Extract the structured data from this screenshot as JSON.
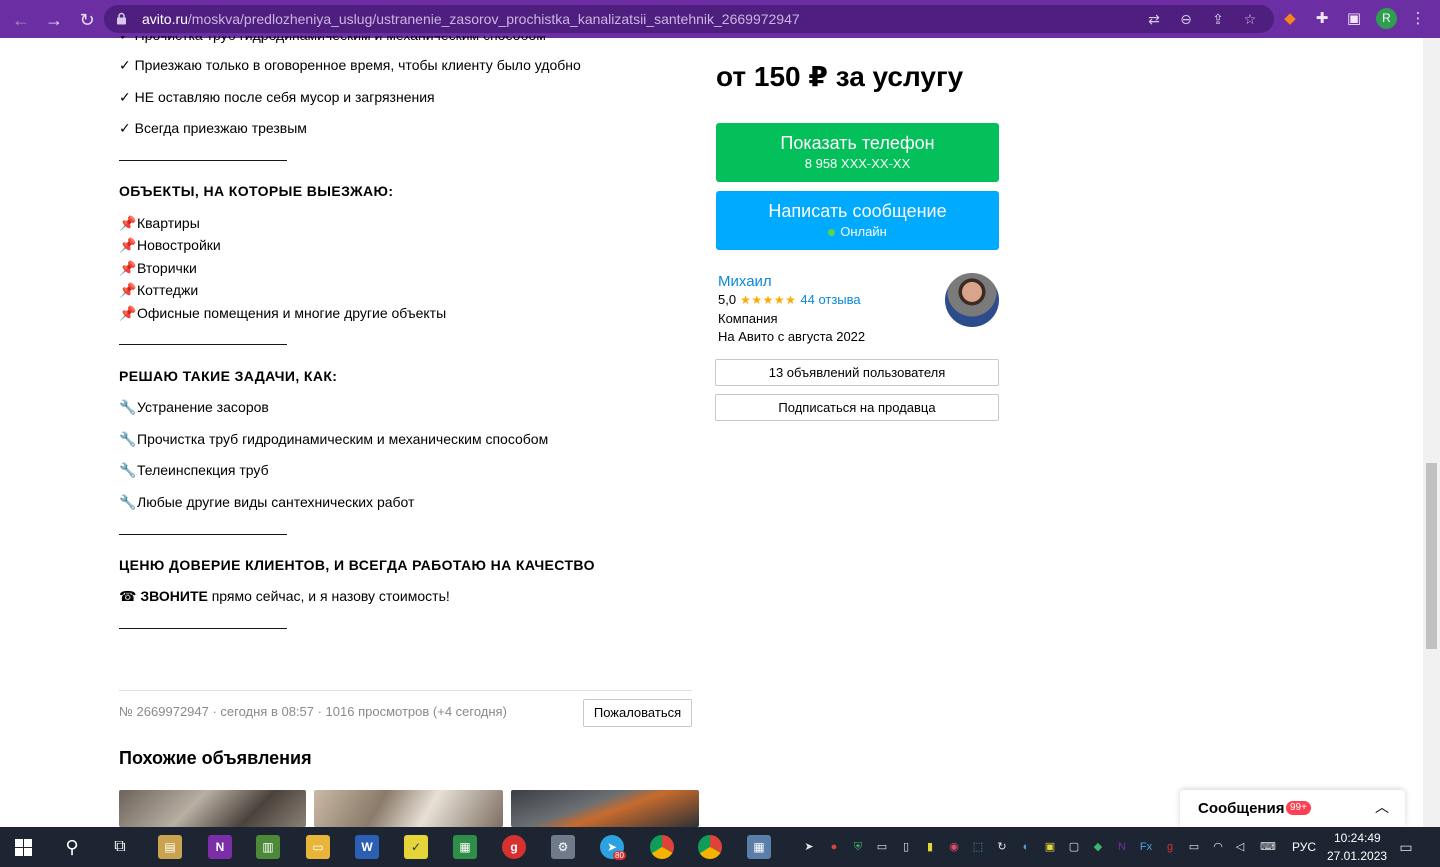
{
  "browser": {
    "url_host": "avito.ru",
    "url_path": "/moskva/predlozheniya_uslug/ustranenie_zasorov_prochistka_kanalizatsii_santehnik_2669972947",
    "profile_initial": "R"
  },
  "description": {
    "partial_top": "✓ Прочистка труб гидродинамическим и механическим способом",
    "checks": [
      "✓ Приезжаю только в оговоренное время, чтобы клиенту было удобно",
      "✓ НЕ оставляю после себя мусор и загрязнения",
      "✓ Всегда приезжаю трезвым"
    ],
    "separator": "————————————",
    "objects_heading": "ОБЪЕКТЫ, НА КОТОРЫЕ ВЫЕЗЖАЮ:",
    "objects": [
      "Квартиры",
      "Новостройки",
      "Вторички",
      "Коттеджи",
      "Офисные помещения и многие другие объекты"
    ],
    "tasks_heading": "РЕШАЮ ТАКИЕ ЗАДАЧИ, КАК:",
    "tasks": [
      "Устранение засоров",
      "Прочистка труб гидродинамическим и механическим способом",
      "Телеинспекция труб",
      "Любые другие виды сантехнических работ"
    ],
    "quality_heading": "ЦЕНЮ ДОВЕРИЕ КЛИЕНТОВ, И ВСЕГДА РАБОТАЮ НА КАЧЕСТВО",
    "call_icon": "☎",
    "call_bold": "ЗВОНИТЕ",
    "call_rest": " прямо сейчас, и я назову стоимость!"
  },
  "listing_meta": {
    "text": "№ 2669972947 · сегодня в 08:57 · 1016 просмотров (+4 сегодня)",
    "complain_label": "Пожаловаться"
  },
  "similar": {
    "title": "Похожие объявления"
  },
  "sidebar": {
    "price": "от 150 ₽ за услугу",
    "phone_button": "Показать телефон",
    "phone_number": "8 958 XXX-XX-XX",
    "message_button": "Написать сообщение",
    "online_status": "Онлайн",
    "seller_name": "Михаил",
    "rating": "5,0",
    "stars": "★★★★★",
    "reviews": "44 отзыва",
    "seller_type": "Компания",
    "seller_since": "На Авито с августа 2022",
    "listings_button": "13 объявлений пользователя",
    "subscribe_button": "Подписаться на продавца"
  },
  "messages_widget": {
    "label": "Сообщения",
    "badge": "99+"
  },
  "taskbar": {
    "language": "РУС",
    "time": "10:24:49",
    "date": "27.01.2023",
    "telegram_badge": "80"
  },
  "colors": {
    "chrome": "#6b2fa3",
    "phone_button": "#04c05a",
    "message_button": "#00aaff",
    "link": "#0a89d8",
    "star": "#ffaa00",
    "badge": "#ff4053"
  }
}
